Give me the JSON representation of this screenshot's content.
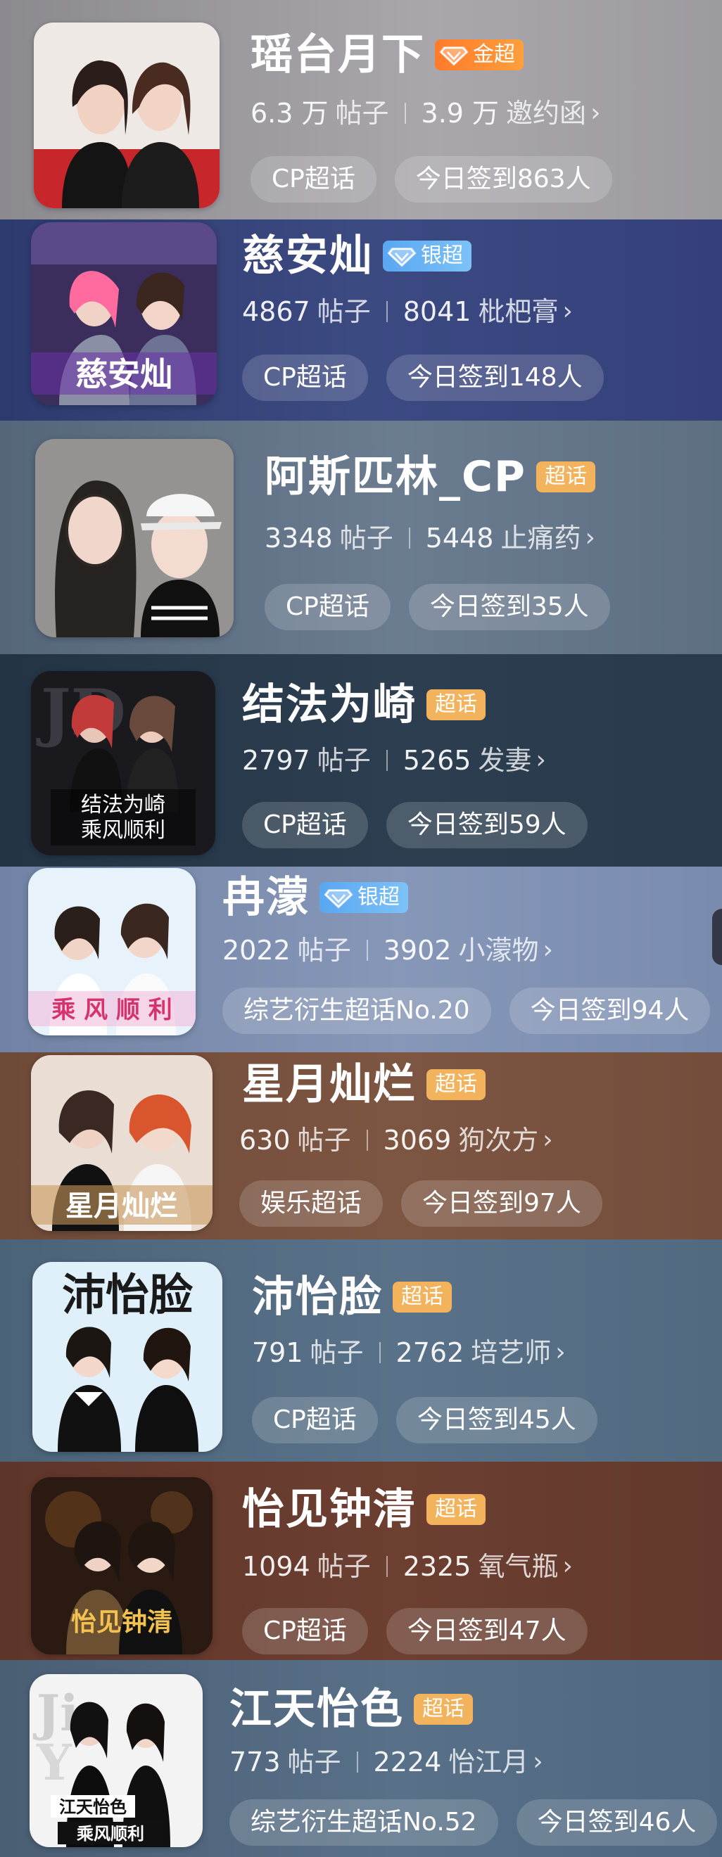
{
  "cards": [
    {
      "title": "瑶台月下",
      "badge": "金超",
      "posts": "6.3 万",
      "posts_unit": "帖子",
      "fans": "3.9 万",
      "fans_name": "邀约函",
      "tag1": "CP超话",
      "tag2": "今日签到863人"
    },
    {
      "title": "慈安灿",
      "badge": "银超",
      "posts": "4867",
      "posts_unit": "帖子",
      "fans": "8041",
      "fans_name": "枇杷膏",
      "tag1": "CP超话",
      "tag2": "今日签到148人",
      "thumb_text": "慈安灿"
    },
    {
      "title": "阿斯匹林_CP",
      "badge": "超话",
      "posts": "3348",
      "posts_unit": "帖子",
      "fans": "5448",
      "fans_name": "止痛药",
      "tag1": "CP超话",
      "tag2": "今日签到35人"
    },
    {
      "title": "结法为崎",
      "badge": "超话",
      "posts": "2797",
      "posts_unit": "帖子",
      "fans": "5265",
      "fans_name": "发妻",
      "tag1": "CP超话",
      "tag2": "今日签到59人",
      "thumb_text": "结法为崎",
      "thumb_text2": "乘风顺利"
    },
    {
      "title": "冉濛",
      "badge": "银超",
      "posts": "2022",
      "posts_unit": "帖子",
      "fans": "3902",
      "fans_name": "小濛物",
      "tag1": "综艺衍生超话No.20",
      "tag2": "今日签到94人",
      "thumb_text": "乘 风 顺 利"
    },
    {
      "title": "星月灿烂",
      "badge": "超话",
      "posts": "630",
      "posts_unit": "帖子",
      "fans": "3069",
      "fans_name": "狗次方",
      "tag1": "娱乐超话",
      "tag2": "今日签到97人",
      "thumb_text": "星月灿烂"
    },
    {
      "title": "沛怡脸",
      "badge": "超话",
      "posts": "791",
      "posts_unit": "帖子",
      "fans": "2762",
      "fans_name": "培艺师",
      "tag1": "CP超话",
      "tag2": "今日签到45人",
      "thumb_text": "沛怡脸"
    },
    {
      "title": "怡见钟清",
      "badge": "超话",
      "posts": "1094",
      "posts_unit": "帖子",
      "fans": "2325",
      "fans_name": "氧气瓶",
      "tag1": "CP超话",
      "tag2": "今日签到47人",
      "thumb_text": "怡见钟清"
    },
    {
      "title": "江天怡色",
      "badge": "超话",
      "posts": "773",
      "posts_unit": "帖子",
      "fans": "2224",
      "fans_name": "怡江月",
      "tag1": "综艺衍生超话No.52",
      "tag2": "今日签到46人",
      "thumb_text": "江天怡色",
      "thumb_text2": "乘风顺利"
    }
  ],
  "icons": {
    "chevron": "chevron-right-icon",
    "gem": "diamond-icon"
  },
  "colors": {
    "gold_badge": "#ff8a30",
    "silver_badge": "#6cb4f4",
    "super_badge": "#f2b35c"
  }
}
